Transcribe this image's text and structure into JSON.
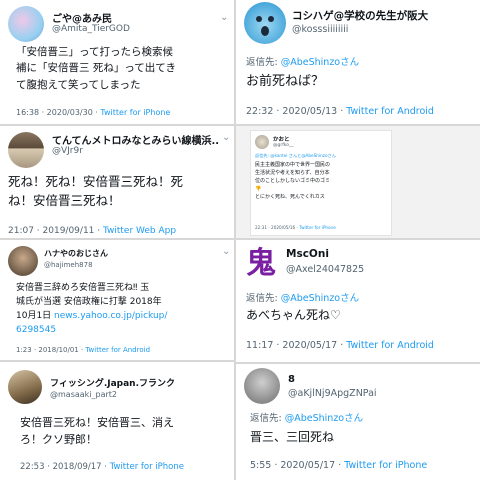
{
  "tweets": [
    {
      "display_name": "ごや@あみ民",
      "handle": "@Amita_TierGOD",
      "text": "「安倍晋三」って打ったら検索候\n補に「安倍晋三 死ね」って出てき\nて腹抱えて笑ってしまった",
      "time": "16:38 · 2020/03/30 · ",
      "source": "Twitter for iPhone"
    },
    {
      "display_name": "てんてんメトロみなとみらい線横浜...",
      "handle": "@VJr9r",
      "text": "死ね！死ね！安倍晋三死ね！死\nね！安倍晋三死ね！",
      "time": "21:07 · 2019/09/11 · ",
      "source": "Twitter Web App"
    },
    {
      "display_name": "ハナやのおじさん",
      "handle": "@hajimeh878",
      "text_pre": "安倍晋三辞めろ安倍晋三死ね‼︎ 玉\n城氏が当選 安倍政権に打撃 2018年\n10月1日 ",
      "link": "news.yahoo.co.jp/pickup/\n6298545",
      "time": "1:23 · 2018/10/01 · ",
      "source": "Twitter for Android"
    },
    {
      "display_name": "フィッシング.Japan.フランク",
      "handle": "@masaaki_part2",
      "text": "安倍晋三死ね！安倍晋三、消え\nろ！クソ野郎！",
      "time": "22:53 · 2018/09/17 · ",
      "source": "Twitter for iPhone"
    },
    {
      "display_name": "コシハゲ@学校の先生が阪大",
      "handle": "@kosssiiiiiiii",
      "reply_prefix": "返信先: ",
      "reply_to": "@AbeShinzoさん",
      "text": "お前死ねば？",
      "time": "22:32 · 2020/05/13 · ",
      "source": "Twitter for Android"
    },
    {
      "display_name": "かおと",
      "handle": "@grfko__",
      "reply_line": "返信先: @kantei さんと@AbeShinzoさん",
      "text": "民主主義国家の中で世界一国民の\n生活状況や考えを知らず、自分本\n位のことしかしないゴミ中のゴミ\n👎\nとにかく死ね、死んでくれカス",
      "time": "22:31 · 2020/05/16 · ",
      "source": "Twitter for iPhone"
    },
    {
      "display_name": "MscOni",
      "handle": "@Axel24047825",
      "avatar_glyph": "鬼",
      "reply_prefix": "返信先: ",
      "reply_to": "@AbeShinzoさん",
      "text": "あべちゃん死ね♡",
      "time": "11:17 · 2020/05/17 · ",
      "source": "Twitter for Android"
    },
    {
      "display_name": "8",
      "handle": "@aKjlNj9ApgZNPai",
      "reply_prefix": "返信先: ",
      "reply_to": "@AbeShinzoさん",
      "text": "晋三、三回死ね",
      "time": "5:55 · 2020/05/17 · ",
      "source": "Twitter for iPhone"
    }
  ]
}
